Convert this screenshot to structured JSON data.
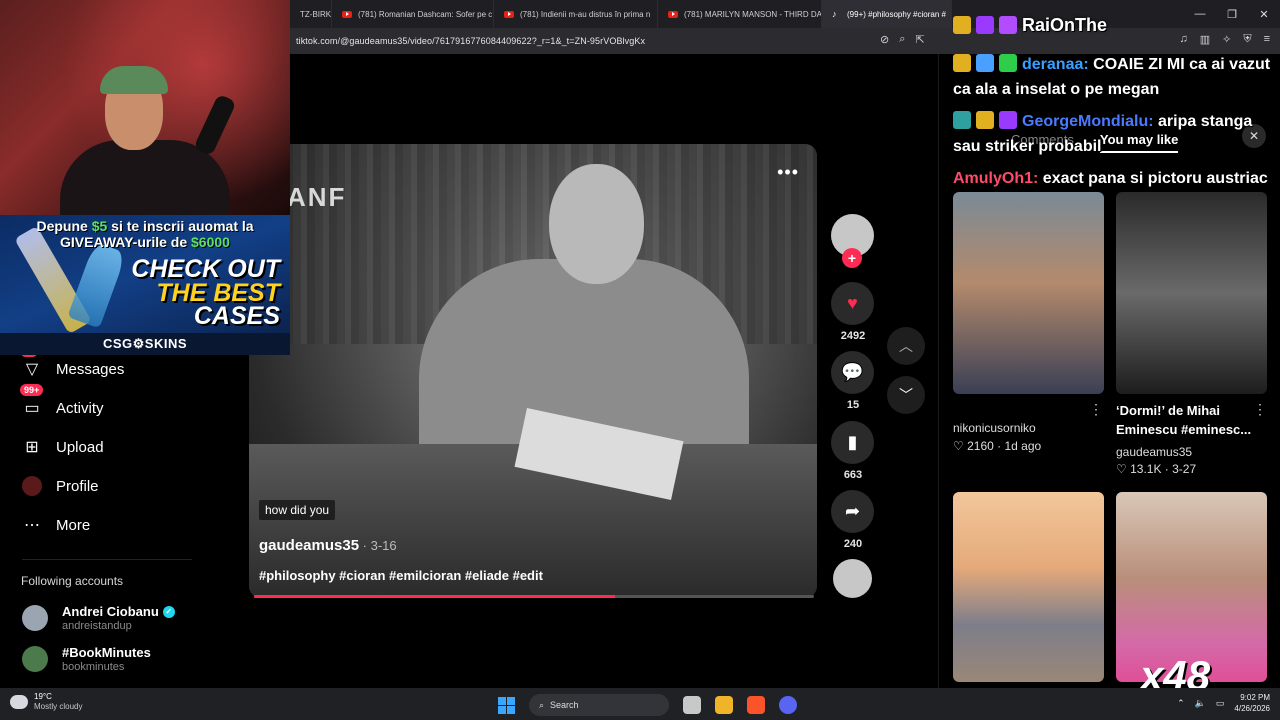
{
  "browser": {
    "tabs": [
      {
        "label": "TZ-BIRKE",
        "icon": "youtube-icon",
        "active": false
      },
      {
        "label": "(781) Romanian Dashcam: Sofer pe c",
        "icon": "youtube-icon",
        "active": false
      },
      {
        "label": "(781) Indienii m-au distrus în prima n",
        "icon": "youtube-icon",
        "active": false
      },
      {
        "label": "(781) MARILYN MANSON - THIRD DA",
        "icon": "youtube-icon",
        "active": false
      },
      {
        "label": "(99+) #philosophy #cioran #",
        "icon": "tiktok-icon",
        "active": true
      }
    ],
    "url": "tiktok.com/@gaudeamus35/video/7617916776084409622?_r=1&_t=ZN-95rVOBlvgKx"
  },
  "sidebar": {
    "items": [
      {
        "label": "Messages",
        "icon": "messages-icon",
        "badge": "40"
      },
      {
        "label": "Activity",
        "icon": "activity-icon",
        "badge": "99+"
      },
      {
        "label": "Upload",
        "icon": "upload-icon",
        "badge": ""
      },
      {
        "label": "Profile",
        "icon": "profile-icon",
        "badge": ""
      },
      {
        "label": "More",
        "icon": "more-icon",
        "badge": ""
      }
    ],
    "following_heading": "Following accounts",
    "following": [
      {
        "name": "Andrei Ciobanu",
        "handle": "andreistandup",
        "verified": true
      },
      {
        "name": "#BookMinutes",
        "handle": "bookminutes",
        "verified": false
      }
    ]
  },
  "promo": {
    "line1_pre": "Depune ",
    "line1_amount": "$5",
    "line1_post": " si te inscrii auomat la",
    "line2_pre": "GIVEAWAY-urile de ",
    "line2_amount": "$6000",
    "cta_1": "CHECK OUT",
    "cta_2": "THE BEST",
    "cta_3": "CASES",
    "brand": "CSG⚙SKINS"
  },
  "video": {
    "overlay_text": "ANF",
    "caption": "how did you",
    "author": "gaudeamus35",
    "date": " · 3-16",
    "tags": "#philosophy #cioran #emilcioran #eliade #edit",
    "progress": 0.645,
    "likes": "2492",
    "comments": "15",
    "saves": "663",
    "shares": "240"
  },
  "right_panel": {
    "tab_comments": "Comments",
    "tab_you_may_like": "You may like",
    "videos": [
      {
        "title": "",
        "author": "nikonicusorniko",
        "likes": "2160",
        "date": "1d ago"
      },
      {
        "title": "‘Dormi!’ de Mihai Eminescu #eminesc...",
        "author": "gaudeamus35",
        "likes": "13.1K",
        "date": "3-27"
      }
    ]
  },
  "chat": {
    "messages": [
      {
        "user": "RaiOnThe",
        "text": ""
      },
      {
        "user": "deranaa:",
        "text": " COAIE ZI MI ca ai vazut ca ala a inselat o pe megan"
      },
      {
        "user": "GeorgeMondialu:",
        "text": " aripa stanga sau striker probabil"
      },
      {
        "user": "AmulyOh1:",
        "text": " exact pana si pictoru austriac"
      }
    ],
    "combo": "x48"
  },
  "taskbar": {
    "temperature": "19°C",
    "weather": "Mostly cloudy",
    "search": "Search",
    "time": "9:02 PM",
    "date": "4/26/2026"
  },
  "colors": {
    "accent": "#fe2c55",
    "verified": "#20d5ec"
  }
}
